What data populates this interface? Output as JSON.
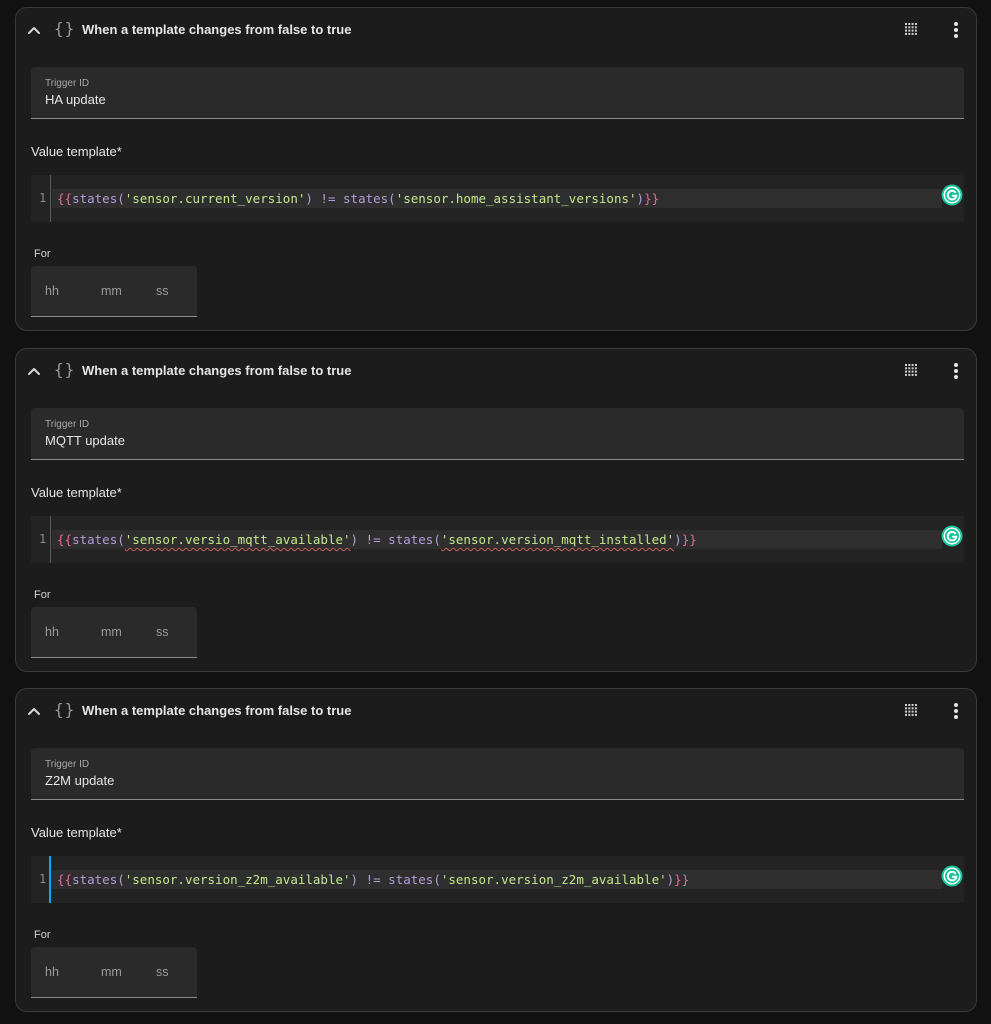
{
  "colors": {
    "background": "#111111",
    "card": "#1c1c1c",
    "field": "#2a2a2a",
    "accent": "#03a9f4",
    "grammarly": "#15c39a"
  },
  "icons": {
    "collapse": "chevron-up-icon",
    "trigger_type": "braces-icon",
    "drag": "drag-handle-icon",
    "menu": "dots-vertical-icon",
    "assistant": "grammarly-icon"
  },
  "triggers": [
    {
      "title": "When a template changes from false to true",
      "trigger_id_label": "Trigger ID",
      "trigger_id_value": "HA update",
      "value_template_label": "Value template*",
      "line_number": "1",
      "code": {
        "open": "{{",
        "fn1": "states(",
        "str1": "'sensor.current_version'",
        "close1": ")",
        "op": " != ",
        "fn2": "states(",
        "str2": "'sensor.home_assistant_versions'",
        "close2": ")",
        "close": "}}"
      },
      "for_label": "For",
      "for_units": {
        "hh": "hh",
        "mm": "mm",
        "ss": "ss"
      }
    },
    {
      "title": "When a template changes from false to true",
      "trigger_id_label": "Trigger ID",
      "trigger_id_value": "MQTT update",
      "value_template_label": "Value template*",
      "line_number": "1",
      "code": {
        "open": "{{",
        "fn1": "states(",
        "str1": "'sensor.versio_mqtt_available'",
        "close1": ")",
        "op": " != ",
        "fn2": "states(",
        "str2": "'sensor.version_mqtt_installed'",
        "close2": ")",
        "close": "}}"
      },
      "for_label": "For",
      "for_units": {
        "hh": "hh",
        "mm": "mm",
        "ss": "ss"
      }
    },
    {
      "title": "When a template changes from false to true",
      "trigger_id_label": "Trigger ID",
      "trigger_id_value": "Z2M update",
      "value_template_label": "Value template*",
      "line_number": "1",
      "code": {
        "open": "{{",
        "fn1": "states(",
        "str1": "'sensor.version_z2m_available'",
        "close1": ")",
        "op": " != ",
        "fn2": "states(",
        "str2": "'sensor.version_z2m_available'",
        "close2": ")",
        "close": "}}"
      },
      "for_label": "For",
      "for_units": {
        "hh": "hh",
        "mm": "mm",
        "ss": "ss"
      }
    }
  ]
}
